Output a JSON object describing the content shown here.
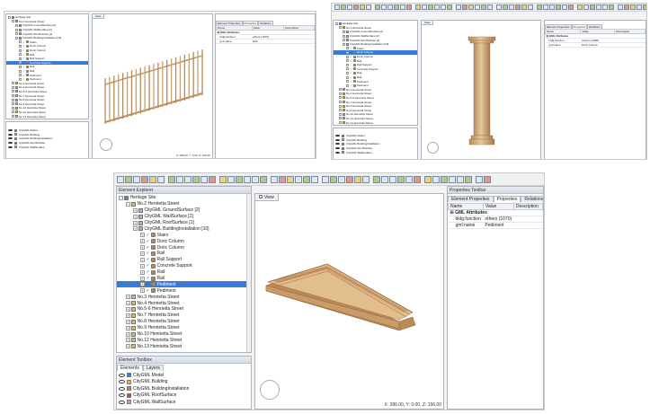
{
  "main": {
    "panel_titles": {
      "explorer": "Element Explorer",
      "toolbox": "Element Toolbox",
      "properties": "Properties Toolbar"
    },
    "tree": [
      {
        "label": "Heritage Site",
        "indent": 0,
        "exp": "−",
        "icon": "site"
      },
      {
        "label": "No.2 Henrietta Street",
        "indent": 1,
        "exp": "−",
        "icon": "bldg"
      },
      {
        "label": "CityGML GroundSurface [2]",
        "indent": 2,
        "exp": "+",
        "icon": "surf"
      },
      {
        "label": "CityGML WallSurface [2]",
        "indent": 2,
        "exp": "+",
        "icon": "surf"
      },
      {
        "label": "CityGML RoofSurface [1]",
        "indent": 2,
        "exp": "+",
        "icon": "surf"
      },
      {
        "label": "CityGML BuildingInstallation [10]",
        "indent": 2,
        "exp": "−",
        "icon": "surf"
      },
      {
        "label": "Stairs",
        "indent": 3,
        "exp": "+",
        "icon": "part",
        "chk": true
      },
      {
        "label": "Doric Column",
        "indent": 3,
        "exp": "+",
        "icon": "part",
        "chk": true
      },
      {
        "label": "Doric Column",
        "indent": 3,
        "exp": "+",
        "icon": "part",
        "chk": true
      },
      {
        "label": "Rail",
        "indent": 3,
        "exp": "+",
        "icon": "part",
        "chk": true
      },
      {
        "label": "Rail Support",
        "indent": 3,
        "exp": "+",
        "icon": "part",
        "chk": true
      },
      {
        "label": "Concrete Support",
        "indent": 3,
        "exp": "+",
        "icon": "part",
        "chk": true
      },
      {
        "label": "Rail",
        "indent": 3,
        "exp": "+",
        "icon": "part",
        "chk": true
      },
      {
        "label": "Rail",
        "indent": 3,
        "exp": "+",
        "icon": "part",
        "chk": true
      },
      {
        "label": "Pediment",
        "indent": 3,
        "exp": "+",
        "icon": "part",
        "chk": true,
        "selected": true
      },
      {
        "label": "Pediment",
        "indent": 3,
        "exp": "+",
        "icon": "part",
        "chk": true
      },
      {
        "label": "No.3 Henrietta Street",
        "indent": 1,
        "exp": "+",
        "icon": "bldg"
      },
      {
        "label": "No.4 Henrietta Street",
        "indent": 1,
        "exp": "+",
        "icon": "bldg"
      },
      {
        "label": "No.5-6 Henrietta Street",
        "indent": 1,
        "exp": "+",
        "icon": "bldg"
      },
      {
        "label": "No.7 Henrietta Street",
        "indent": 1,
        "exp": "+",
        "icon": "bldg"
      },
      {
        "label": "No.8 Henrietta Street",
        "indent": 1,
        "exp": "+",
        "icon": "bldg"
      },
      {
        "label": "No.9 Henrietta Street",
        "indent": 1,
        "exp": "+",
        "icon": "bldg"
      },
      {
        "label": "No.10 Henrietta Street",
        "indent": 1,
        "exp": "+",
        "icon": "bldg"
      },
      {
        "label": "No.12 Henrietta Street",
        "indent": 1,
        "exp": "+",
        "icon": "bldg"
      },
      {
        "label": "No.13 Henrietta Street",
        "indent": 1,
        "exp": "+",
        "icon": "bldg"
      }
    ],
    "toolbox_tabs": [
      "Elements",
      "Layers"
    ],
    "layers": [
      "CityGML Model",
      "CityGML Building",
      "CityGML BuildingInstallation",
      "CityGML RoofSurface",
      "CityGML WallSurface"
    ],
    "view_tab": "View",
    "coords": "X: 286.00, Y: 0.00, Z: 156.00",
    "property_tabs": [
      "Element Properties",
      "Properties",
      "Relations"
    ],
    "property_headers": [
      "Name",
      "Value",
      "Description"
    ],
    "attr_group": "GML Attributes",
    "properties": [
      {
        "name": "bldg:function",
        "value": "others (1070)"
      },
      {
        "name": "gml:name",
        "value": "Pediment"
      }
    ]
  },
  "top_left": {
    "coords": "X: 286.00, Y: 0.00, Z: 156.00",
    "properties": [
      {
        "name": "bldg:function",
        "value": "others (1070)"
      },
      {
        "name": "gml:name",
        "value": "Rail"
      }
    ]
  },
  "top_right": {
    "properties": [
      {
        "name": "bldg:function",
        "value": "column (1080)"
      },
      {
        "name": "gml:name",
        "value": "Doric Column"
      }
    ]
  },
  "colors": {
    "object": "#d2a877",
    "object_dark": "#a87d4f",
    "object_light": "#ecd1aa",
    "selection": "#3b7bd8"
  }
}
